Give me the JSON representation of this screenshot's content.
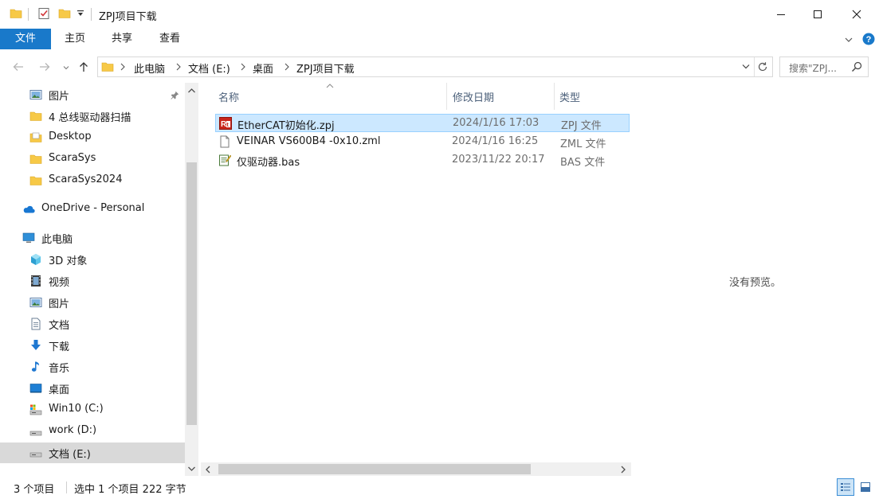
{
  "window": {
    "title": "ZPJ项目下载"
  },
  "ribbon": {
    "tabs": [
      "文件",
      "主页",
      "共享",
      "查看"
    ]
  },
  "address": {
    "crumbs": [
      "此电脑",
      "文档 (E:)",
      "桌面",
      "ZPJ项目下载"
    ]
  },
  "search": {
    "placeholder": "搜索\"ZPJ..."
  },
  "nav": {
    "items": [
      {
        "label": "图片",
        "icon": "pictures-icon",
        "indent": 1,
        "pinned": true
      },
      {
        "label": "4 总线驱动器扫描",
        "icon": "folder-icon",
        "indent": 1
      },
      {
        "label": "Desktop",
        "icon": "folder-doc-icon",
        "indent": 1
      },
      {
        "label": "ScaraSys",
        "icon": "folder-icon",
        "indent": 1
      },
      {
        "label": "ScaraSys2024",
        "icon": "folder-icon",
        "indent": 1
      },
      {
        "label": "OneDrive - Personal",
        "icon": "onedrive-icon",
        "indent": 0
      },
      {
        "label": "此电脑",
        "icon": "pc-icon",
        "indent": 0
      },
      {
        "label": "3D 对象",
        "icon": "3d-objects-icon",
        "indent": 1
      },
      {
        "label": "视频",
        "icon": "videos-icon",
        "indent": 1
      },
      {
        "label": "图片",
        "icon": "pictures-icon",
        "indent": 1
      },
      {
        "label": "文档",
        "icon": "documents-icon",
        "indent": 1
      },
      {
        "label": "下载",
        "icon": "downloads-icon",
        "indent": 1
      },
      {
        "label": "音乐",
        "icon": "music-icon",
        "indent": 1
      },
      {
        "label": "桌面",
        "icon": "desktop-icon",
        "indent": 1
      },
      {
        "label": "Win10 (C:)",
        "icon": "system-drive-icon",
        "indent": 1
      },
      {
        "label": "work (D:)",
        "icon": "drive-icon",
        "indent": 1
      },
      {
        "label": "文档 (E:)",
        "icon": "drive-icon",
        "indent": 1,
        "selected": true
      }
    ]
  },
  "files": {
    "columns": {
      "name": "名称",
      "date": "修改日期",
      "type": "类型"
    },
    "rows": [
      {
        "name": "EtherCAT初始化.zpj",
        "date": "2024/1/16 17:03",
        "type": "ZPJ 文件",
        "icon": "zpj-file-icon",
        "selected": true
      },
      {
        "name": "VEINAR VS600B4 -0x10.zml",
        "date": "2024/1/16 16:25",
        "type": "ZML 文件",
        "icon": "text-file-icon"
      },
      {
        "name": "仅驱动器.bas",
        "date": "2023/11/22 20:17",
        "type": "BAS 文件",
        "icon": "bas-file-icon"
      }
    ]
  },
  "preview": {
    "text": "没有预览。"
  },
  "status": {
    "count": "3 个项目",
    "selection": "选中 1 个项目  222 字节"
  },
  "colors": {
    "accent": "#1979ca",
    "selection": "#cce8ff",
    "folder": "#f7c947"
  }
}
